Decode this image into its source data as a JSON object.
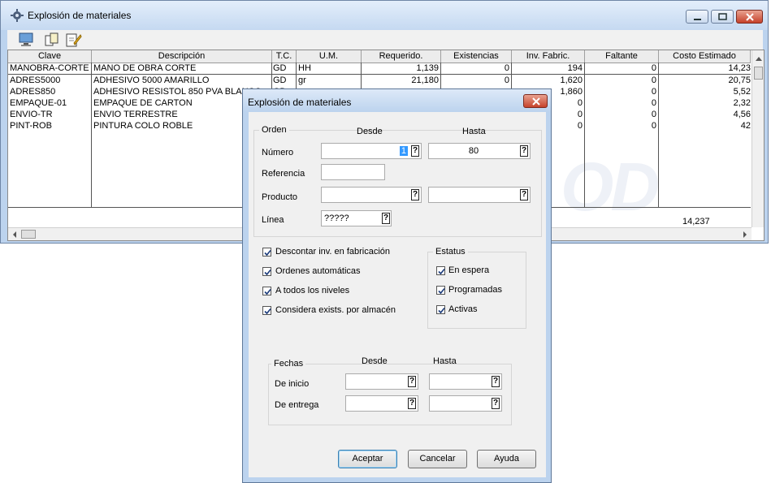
{
  "main_window": {
    "title": "Explosión de materiales",
    "toolbar": [
      "monitor-icon",
      "copy-icon",
      "edit-icon"
    ]
  },
  "grid": {
    "columns": [
      "Clave",
      "Descripción",
      "T.C.",
      "U.M.",
      "Requerido.",
      "Existencias",
      "Inv. Fabric.",
      "Faltante",
      "Costo Estimado"
    ],
    "rows": [
      [
        "MANOBRA-CORTE",
        "MANO DE OBRA CORTE",
        "GD",
        "HH",
        "1,139",
        "0",
        "194",
        "0",
        "14,23"
      ],
      [
        "ADRES5000",
        "ADHESIVO 5000 AMARILLO",
        "GD",
        "gr",
        "21,180",
        "0",
        "1,620",
        "0",
        "20,75"
      ],
      [
        "ADRES850",
        "ADHESIVO RESISTOL 850 PVA BLANCO",
        "GD",
        "gr",
        "",
        "",
        "1,860",
        "0",
        "5,52"
      ],
      [
        "EMPAQUE-01",
        "EMPAQUE DE CARTON",
        "",
        "",
        "",
        "",
        "0",
        "0",
        "2,32"
      ],
      [
        "ENVIO-TR",
        "ENVIO TERRESTRE",
        "",
        "",
        "",
        "",
        "0",
        "0",
        "4,56"
      ],
      [
        "PINT-ROB",
        "PINTURA COLO ROBLE",
        "",
        "",
        "",
        "",
        "0",
        "0",
        "42"
      ]
    ],
    "total": "14,237"
  },
  "dialog": {
    "title": "Explosión de materiales",
    "orden": {
      "group_label": "Orden",
      "desde_label": "Desde",
      "hasta_label": "Hasta",
      "numero_label": "Número",
      "numero_desde": "1",
      "numero_hasta": "80",
      "referencia_label": "Referencia",
      "referencia_value": "",
      "producto_label": "Producto",
      "producto_desde": "",
      "producto_hasta": "",
      "linea_label": "Línea",
      "linea_value": "?????"
    },
    "options": [
      {
        "label": "Descontar inv. en fabricación",
        "checked": true
      },
      {
        "label": "Ordenes automáticas",
        "checked": true
      },
      {
        "label": "A todos los niveles",
        "checked": true
      },
      {
        "label": "Considera exists. por almacén",
        "checked": true
      }
    ],
    "estatus": {
      "group_label": "Estatus",
      "items": [
        {
          "label": "En espera",
          "checked": true
        },
        {
          "label": "Programadas",
          "checked": true
        },
        {
          "label": "Activas",
          "checked": true
        }
      ]
    },
    "fechas": {
      "group_label": "Fechas",
      "desde_label": "Desde",
      "hasta_label": "Hasta",
      "inicio_label": "De inicio",
      "entrega_label": "De entrega"
    },
    "buttons": {
      "accept": "Aceptar",
      "cancel": "Cancelar",
      "help": "Ayuda"
    },
    "question_glyph": "?"
  }
}
